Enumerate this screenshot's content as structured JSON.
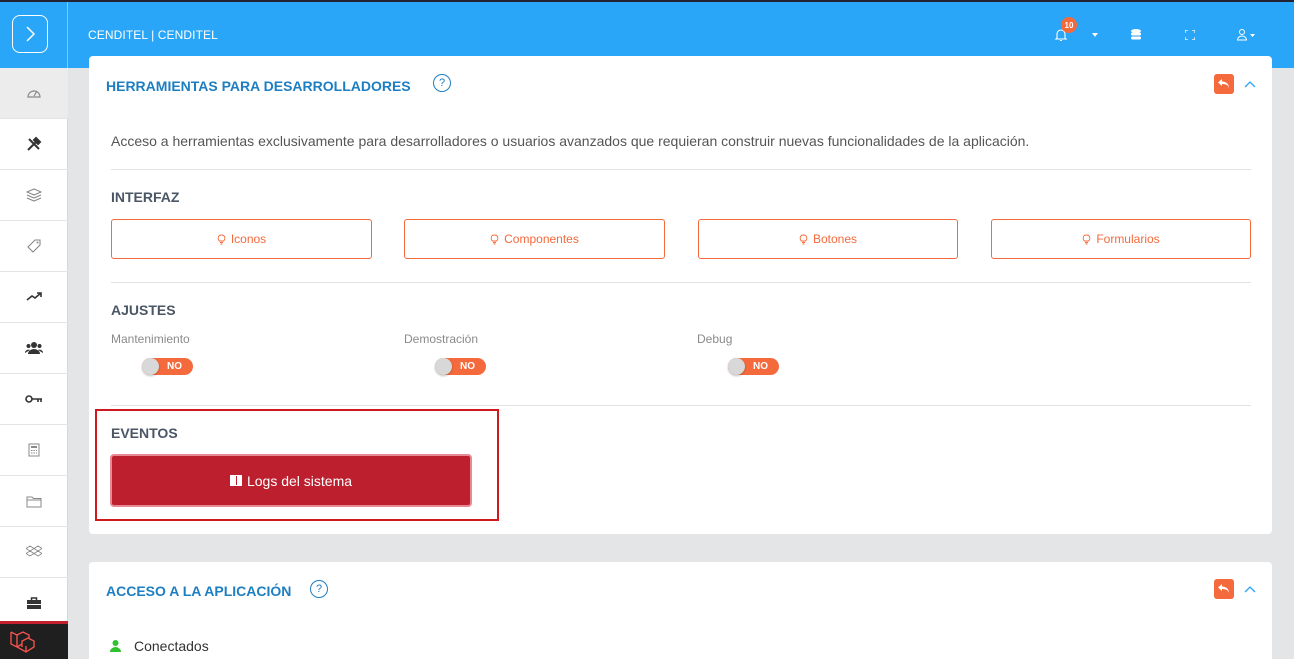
{
  "header": {
    "app_title": "CENDITEL | CENDITEL",
    "notification_count": "10",
    "icons": [
      "chevron-right-icon",
      "bell-icon",
      "caret-down-icon",
      "database-icon",
      "fullscreen-icon",
      "user-icon"
    ]
  },
  "sidebar": {
    "items": [
      {
        "icon": "dashboard-icon"
      },
      {
        "icon": "tools-icon"
      },
      {
        "icon": "layers-icon"
      },
      {
        "icon": "tag-icon"
      },
      {
        "icon": "trending-icon"
      },
      {
        "icon": "users-icon"
      },
      {
        "icon": "key-icon"
      },
      {
        "icon": "calculator-icon"
      },
      {
        "icon": "folder-icon"
      },
      {
        "icon": "dropbox-icon"
      },
      {
        "icon": "briefcase-icon"
      }
    ],
    "logo": "laravel-logo"
  },
  "dev_tools": {
    "title": "HERRAMIENTAS PARA DESARROLLADORES",
    "help": "?",
    "description": "Acceso a herramientas exclusivamente para desarrolladores o usuarios avanzados que requieran construir nuevas funcionalidades de la aplicación.",
    "interfaz": {
      "title": "INTERFAZ",
      "buttons": [
        "Iconos",
        "Componentes",
        "Botones",
        "Formularios"
      ]
    },
    "ajustes": {
      "title": "AJUSTES",
      "toggles": [
        {
          "label": "Mantenimiento",
          "state": "NO"
        },
        {
          "label": "Demostración",
          "state": "NO"
        },
        {
          "label": "Debug",
          "state": "NO"
        }
      ]
    },
    "eventos": {
      "title": "EVENTOS",
      "logs_button": "Logs del sistema"
    }
  },
  "app_access": {
    "title": "ACCESO A LA APLICACIÓN",
    "help": "?",
    "connected_label": "Conectados"
  },
  "colors": {
    "header_blue": "#2aa6f9",
    "accent_orange": "#f46a3c",
    "title_blue": "#1d7ec2",
    "danger_red": "#bd1f2e",
    "highlight_red": "#d0181f"
  }
}
